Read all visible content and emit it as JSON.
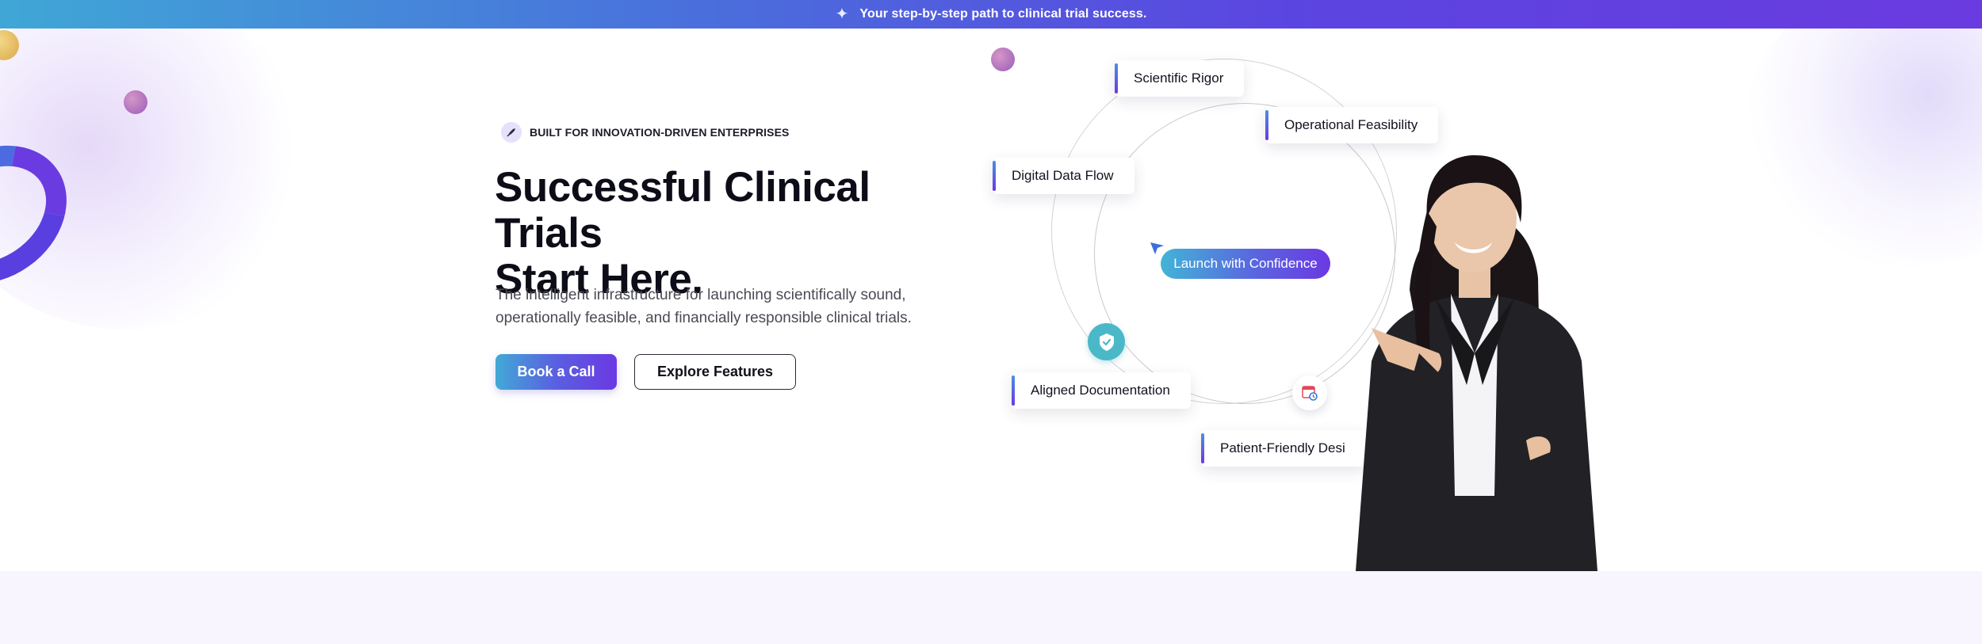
{
  "announcement": {
    "icon": "sparkle-icon",
    "text": "Your step-by-step path to clinical trial success."
  },
  "hero": {
    "eyebrow": {
      "icon": "rocket-icon",
      "text": "BUILT FOR INNOVATION-DRIVEN ENTERPRISES"
    },
    "headline_line1": "Successful Clinical Trials",
    "headline_line2": "Start Here.",
    "subtext_line1": "The intelligent infrastructure for launching scientifically sound,",
    "subtext_line2": "operationally feasible, and financially responsible clinical trials.",
    "primary_cta": "Book a Call",
    "secondary_cta": "Explore Features"
  },
  "orbit": {
    "center_label": "Launch with Confidence",
    "chips": {
      "rigor": "Scientific Rigor",
      "feasibility": "Operational Feasibility",
      "data_flow": "Digital Data Flow",
      "documentation": "Aligned Documentation",
      "patient": "Patient-Friendly Desi"
    },
    "icons": [
      "shield-check-icon",
      "calendar-clock-icon",
      "cursor-arrow-icon"
    ]
  },
  "colors": {
    "brand_blue": "#42a9d6",
    "brand_purple": "#6b39e3",
    "teal": "#4bb8c8",
    "text_dark": "#0d0d18",
    "text_muted": "#4a4a55",
    "band_bg": "#f8f5fe"
  }
}
